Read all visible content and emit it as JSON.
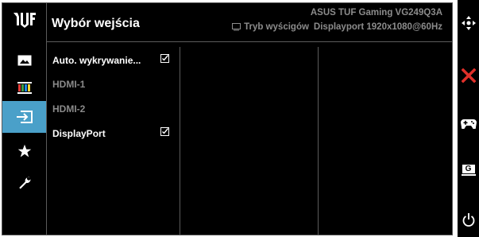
{
  "header": {
    "title": "Wybór wejścia",
    "model": "ASUS TUF Gaming VG249Q3A",
    "mode": "Tryb wyścigów",
    "signal": "Displayport 1920x1080@60Hz"
  },
  "sidebar": {
    "items": [
      {
        "icon": "image-icon"
      },
      {
        "icon": "color-bars-icon"
      },
      {
        "icon": "input-select-icon",
        "active": true
      },
      {
        "icon": "star-icon"
      },
      {
        "icon": "wrench-icon"
      }
    ]
  },
  "options": [
    {
      "label": "Auto. wykrywanie...",
      "checked": true,
      "enabled": true
    },
    {
      "label": "HDMI-1",
      "checked": false,
      "enabled": false
    },
    {
      "label": "HDMI-2",
      "checked": false,
      "enabled": false
    },
    {
      "label": "DisplayPort",
      "checked": true,
      "enabled": true
    }
  ],
  "hotkeys": {
    "items": [
      "navigate-icon",
      "close-icon",
      "gamepad-icon",
      "gameplus-icon",
      "power-icon"
    ],
    "gameplus_letter": "G"
  },
  "colors": {
    "active_highlight": "#4aa0c9",
    "close_red": "#e0302a",
    "background": "#000000",
    "text_primary": "#ffffff",
    "text_dim": "#8a8a8a"
  }
}
